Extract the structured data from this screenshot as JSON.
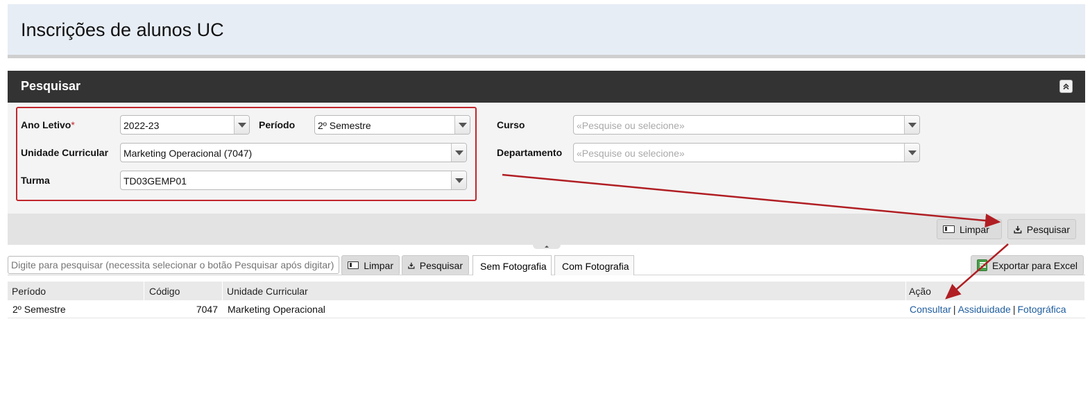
{
  "header": {
    "title": "Inscrições de alunos UC"
  },
  "search_panel": {
    "title": "Pesquisar",
    "fields": {
      "ano_letivo": {
        "label": "Ano Letivo",
        "required_mark": "*",
        "value": "2022-23"
      },
      "periodo": {
        "label": "Período",
        "value": "2º Semestre"
      },
      "curso": {
        "label": "Curso",
        "placeholder": "«Pesquise ou selecione»"
      },
      "unidade_curricular": {
        "label": "Unidade Curricular",
        "value": "Marketing Operacional (7047)"
      },
      "departamento": {
        "label": "Departamento",
        "placeholder": "«Pesquise ou selecione»"
      },
      "turma": {
        "label": "Turma",
        "value": "TD03GEMP01"
      }
    },
    "buttons": {
      "clear": "Limpar",
      "search": "Pesquisar"
    }
  },
  "results": {
    "filter_placeholder": "Digite para pesquisar (necessita selecionar o botão Pesquisar após digitar)",
    "buttons": {
      "clear": "Limpar",
      "search": "Pesquisar",
      "export": "Exportar para Excel"
    },
    "tabs": [
      "Sem Fotografia",
      "Com Fotografia"
    ],
    "columns": [
      "Período",
      "Código",
      "Unidade Curricular",
      "Ação"
    ],
    "rows": [
      {
        "periodo": "2º Semestre",
        "codigo": "7047",
        "unidade_curricular": "Marketing Operacional",
        "actions": [
          "Consultar",
          "Assiduidade",
          "Fotográfica"
        ],
        "separator": "|"
      }
    ]
  },
  "colors": {
    "header_bg": "#e7edf5",
    "section_bar": "#333333",
    "highlight": "#c1272d",
    "link": "#1f5d9e"
  }
}
